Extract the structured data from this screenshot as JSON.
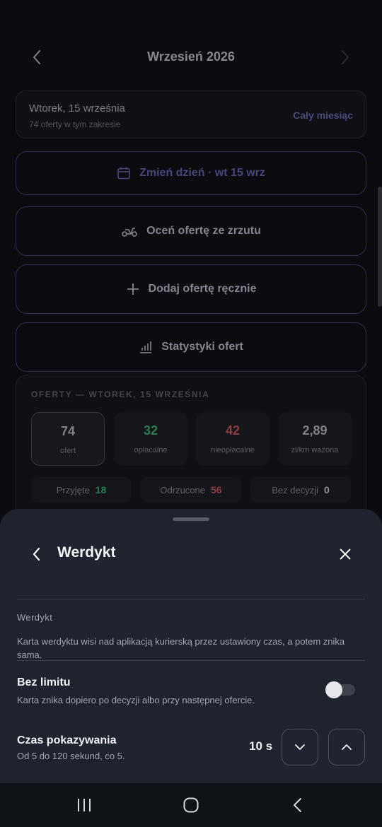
{
  "header": {
    "month_title": "Wrzesień 2026"
  },
  "range": {
    "date_label": "Wtorek, 15 września",
    "count_label": "74 oferty w tym zakresie",
    "whole_month_link": "Cały miesiąc"
  },
  "actions": {
    "change_day": "Zmień dzień · wt 15 wrz",
    "rate_screenshot": "Oceń ofertę ze zrzutu",
    "add_manually": "Dodaj ofertę ręcznie",
    "stats": "Statystyki ofert"
  },
  "offers": {
    "heading": "OFERTY — WTOREK, 15 WRZEŚNIA",
    "stats": [
      {
        "value": "74",
        "label": "ofert"
      },
      {
        "value": "32",
        "label": "opłacalne"
      },
      {
        "value": "42",
        "label": "nieopłacalne"
      },
      {
        "value": "2,89",
        "label": "zł/km ważona"
      }
    ],
    "pills": [
      {
        "label": "Przyjęte",
        "value": "18"
      },
      {
        "label": "Odrzucone",
        "value": "56"
      },
      {
        "label": "Bez decyzji",
        "value": "0"
      }
    ]
  },
  "sheet": {
    "title": "Werdykt",
    "section_label": "Werdykt",
    "section_desc": "Karta werdyktu wisi nad aplikacją kurierską przez ustawiony czas, a potem znika sama.",
    "no_limit": {
      "title": "Bez limitu",
      "subtitle": "Karta znika dopiero po decyzji albo przy następnej ofercie.",
      "enabled": false
    },
    "duration": {
      "title": "Czas pokazywania",
      "subtitle": "Od 5 do 120 sekund, co 5.",
      "value": "10 s"
    }
  },
  "colors": {
    "page_bg": "#0b0c10",
    "sheet_bg": "#1f232d",
    "accent": "#45457a",
    "positive": "#2b7a4f",
    "negative": "#8f3b3d"
  }
}
